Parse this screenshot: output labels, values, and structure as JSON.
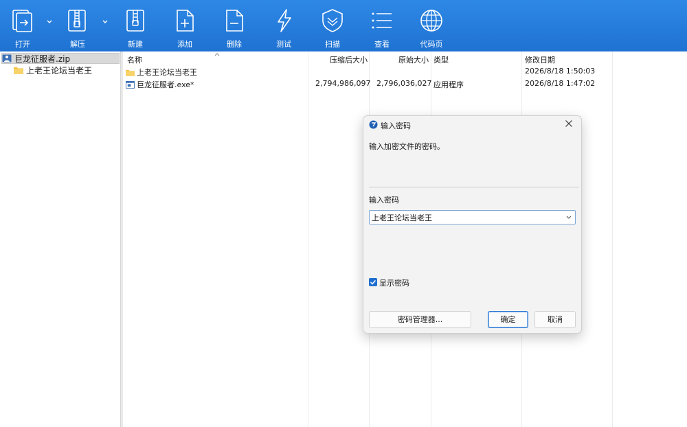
{
  "toolbar": {
    "open": "打开",
    "extract": "解压",
    "new": "新建",
    "add": "添加",
    "delete": "删除",
    "test": "测试",
    "scan": "扫描",
    "view": "查看",
    "codepage": "代码页"
  },
  "tree": {
    "archive": "巨龙征服者.zip",
    "folder": "上老王论坛当老王"
  },
  "list": {
    "columns": {
      "name": "名称",
      "compressed": "压缩后大小",
      "original": "原始大小",
      "type": "类型",
      "modified": "修改日期"
    },
    "rows": [
      {
        "name": "上老王论坛当老王",
        "compressed": "",
        "original": "",
        "type": "",
        "modified": "2026/8/18 1:50:03"
      },
      {
        "name": "巨龙征服者.exe*",
        "compressed": "2,794,986,097",
        "original": "2,796,036,027",
        "type": "应用程序",
        "modified": "2026/8/18 1:47:02"
      }
    ]
  },
  "dialog": {
    "title": "输入密码",
    "message": "输入加密文件的密码。",
    "field_label": "输入密码",
    "password_value": "上老王论坛当老王",
    "show_password": "显示密码",
    "manager_button": "密码管理器...",
    "ok_button": "确定",
    "cancel_button": "取消"
  },
  "colors": {
    "toolbar": "#1f72d2",
    "accent": "#1f6fcf"
  }
}
